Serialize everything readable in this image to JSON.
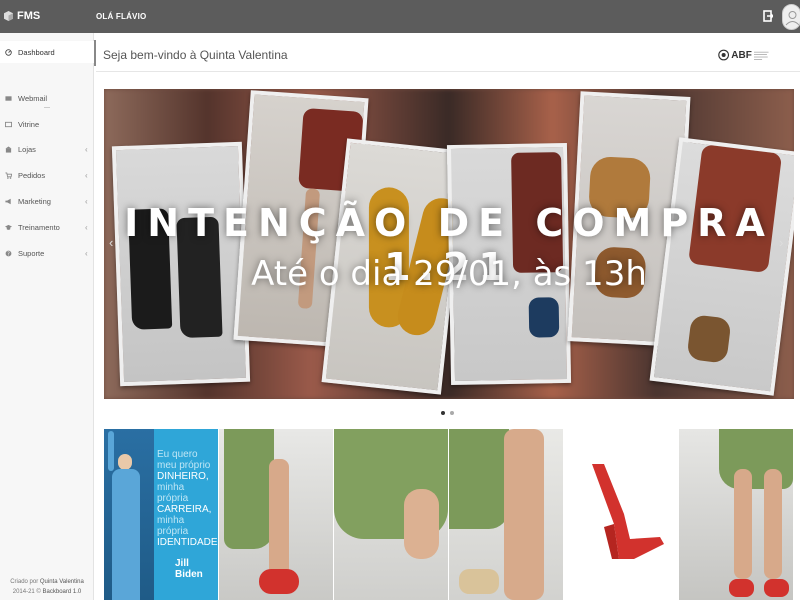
{
  "topbar": {
    "brand": "FMS",
    "greeting": "OLÁ FLÁVIO"
  },
  "sidebar": {
    "items": [
      {
        "label": "Dashboard",
        "icon": "dashboard-icon",
        "chevron": false,
        "active": true
      },
      {
        "label": "Webmail",
        "icon": "mail-icon",
        "chevron": false
      },
      {
        "label": "Vitrine",
        "icon": "showcase-icon",
        "chevron": false
      },
      {
        "label": "Lojas",
        "icon": "store-icon",
        "chevron": true
      },
      {
        "label": "Pedidos",
        "icon": "cart-icon",
        "chevron": true
      },
      {
        "label": "Marketing",
        "icon": "megaphone-icon",
        "chevron": true
      },
      {
        "label": "Treinamento",
        "icon": "graduation-cap-icon",
        "chevron": true
      },
      {
        "label": "Suporte",
        "icon": "help-icon",
        "chevron": true
      }
    ],
    "credits": {
      "created_by_prefix": "Criado por",
      "company": "Quinta Valentina",
      "years": "2014-21 ©",
      "product": "Backboard 1.0"
    }
  },
  "header": {
    "title": "Seja bem-vindo à Quinta Valentina",
    "logo": "ABF"
  },
  "carousel": {
    "title": "INTENÇÃO DE COMPRA 1.21",
    "subtitle": "Até o dia 29/01, às 13h",
    "slide_count": 2,
    "active_slide": 1,
    "prev_glyph": "‹",
    "next_glyph": "›"
  },
  "thumbnails": {
    "jill": {
      "line1": "Eu quero",
      "line2": "meu próprio",
      "line3": "DINHEIRO,",
      "line4": "minha própria",
      "line5": "CARREIRA,",
      "line6": "minha própria",
      "line7": "IDENTIDADE",
      "name": "Jill Biden"
    }
  },
  "colors": {
    "topbar": "#5c5c5c",
    "sidebar": "#f7f7f7",
    "jill_bg": "#2fa6d8",
    "shoe_red": "#d2322d",
    "dress_green": "#7c9a5a"
  }
}
